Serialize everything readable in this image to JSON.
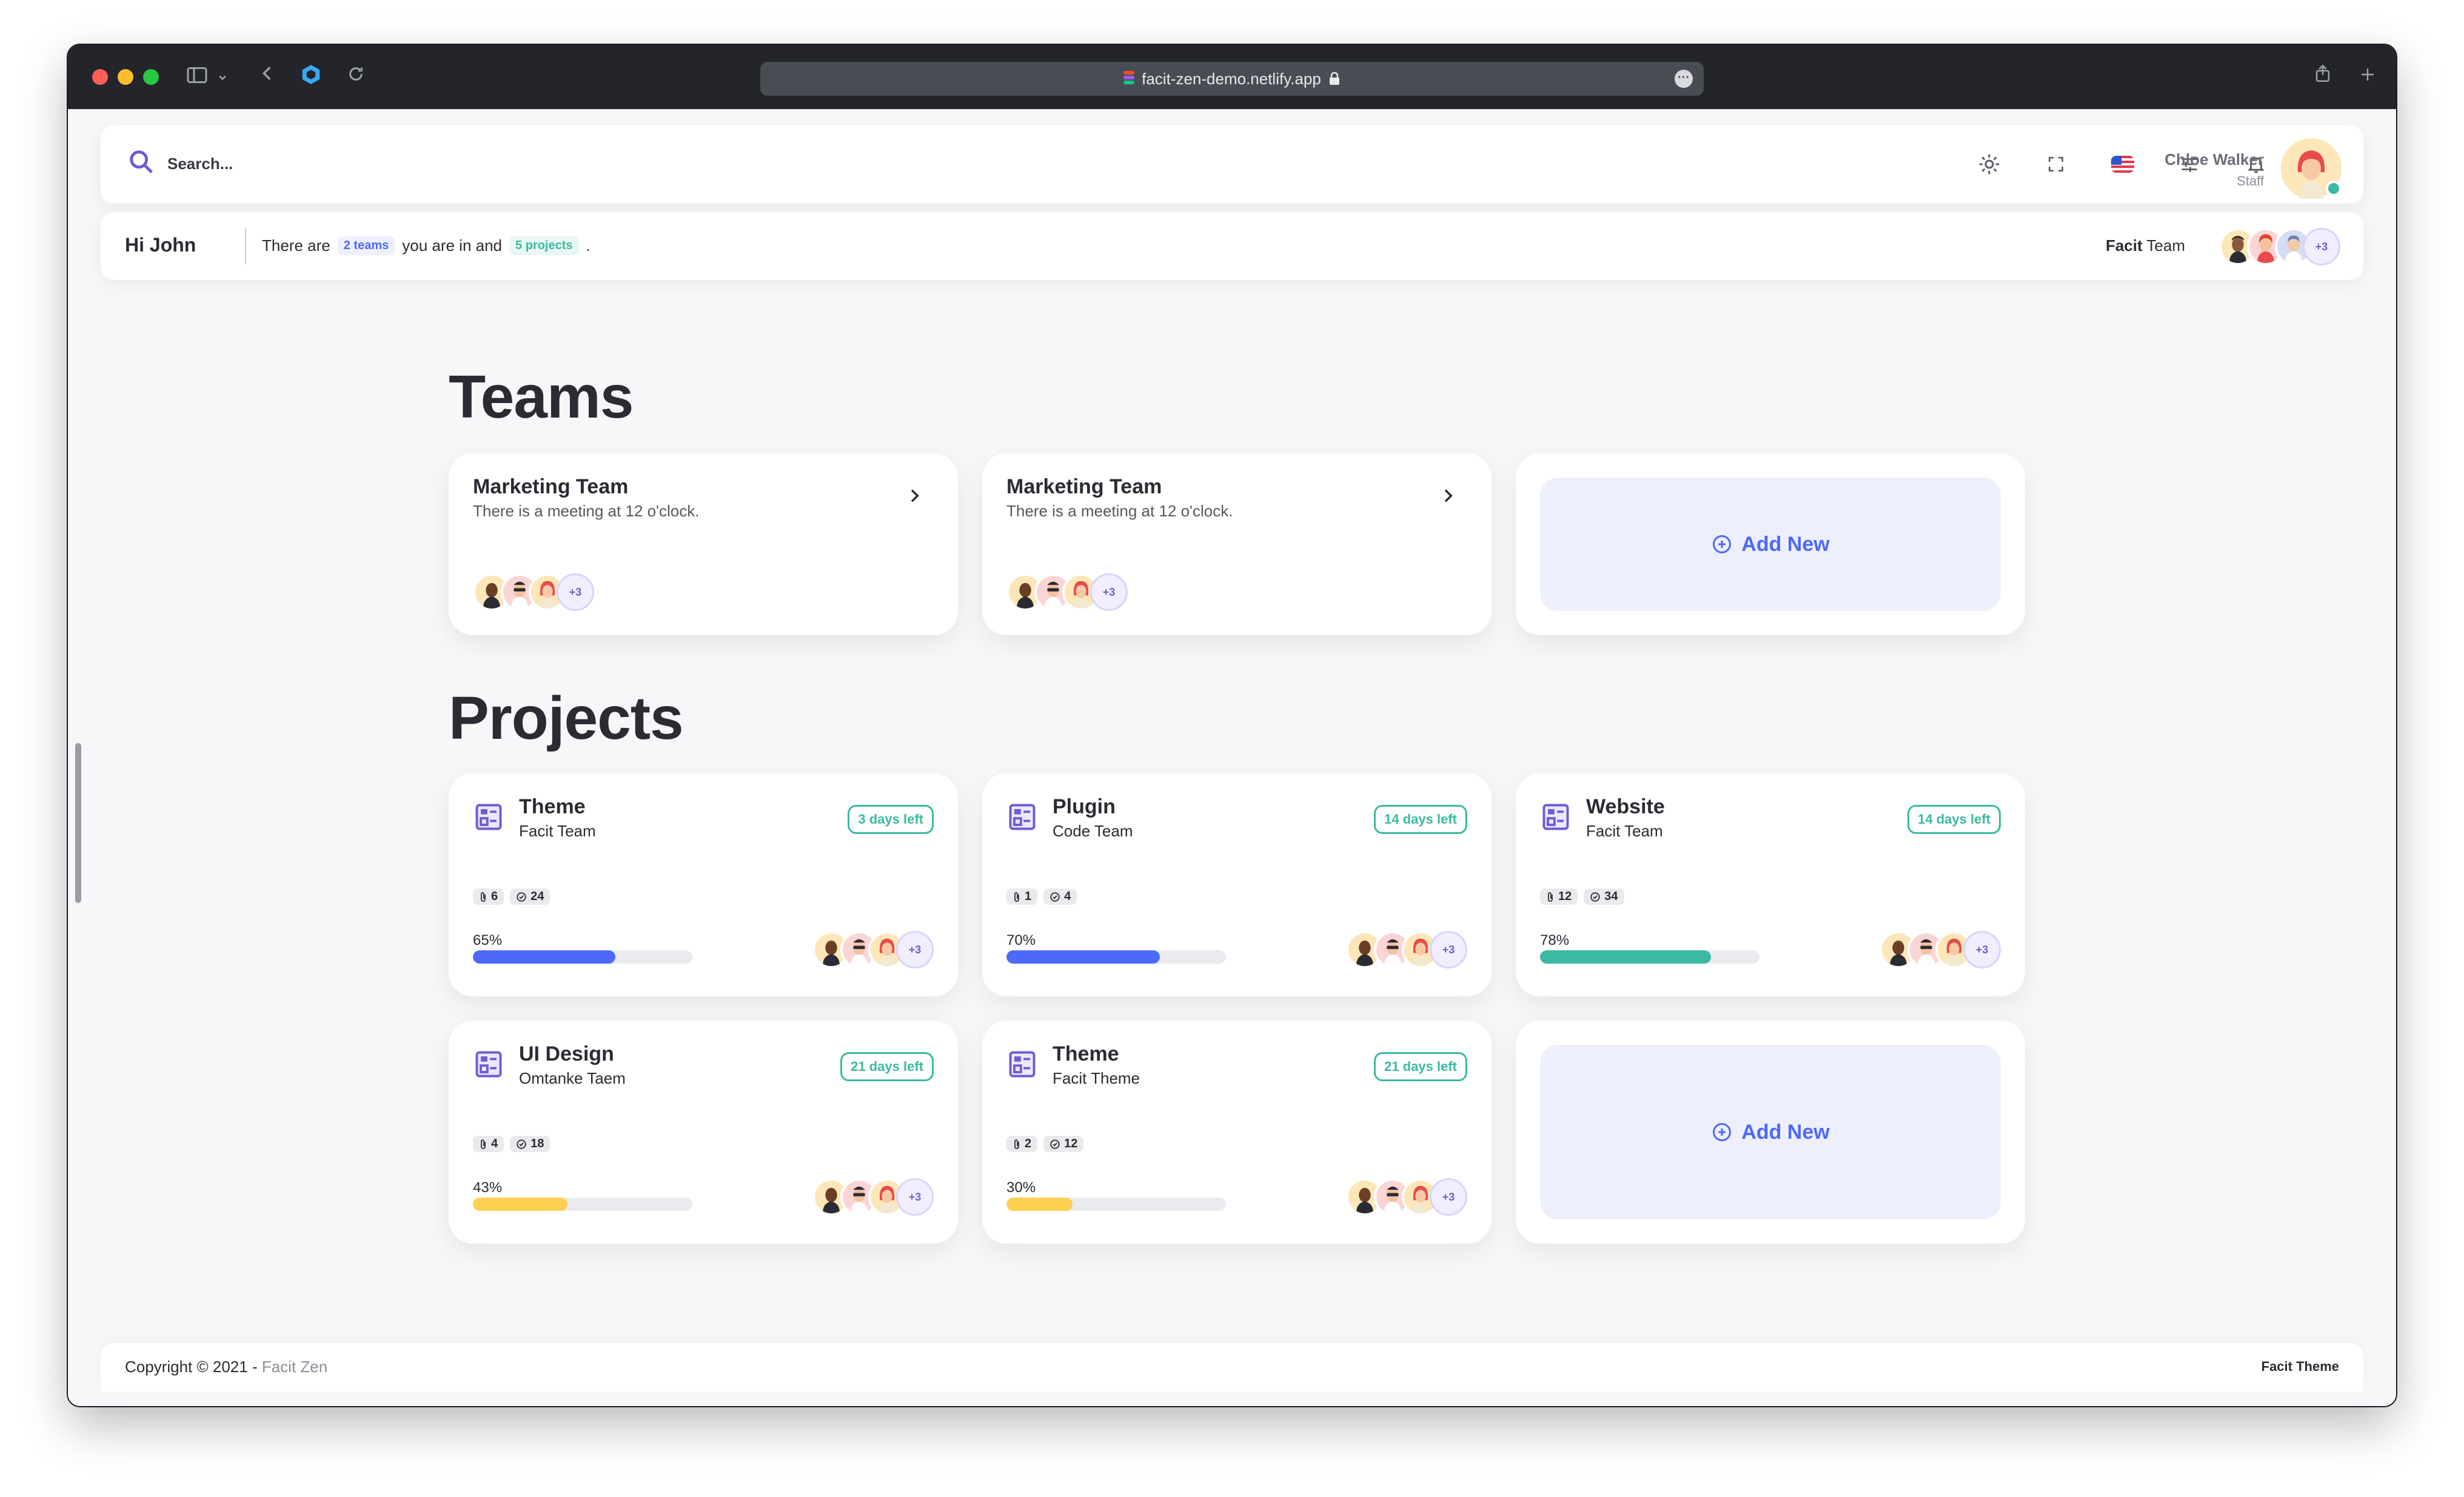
{
  "browser": {
    "url": "facit-zen-demo.netlify.app"
  },
  "header": {
    "search_placeholder": "Search...",
    "user_name": "Chloe Walker",
    "user_role": "Staff"
  },
  "subheader": {
    "greeting": "Hi John",
    "text_before": "There are",
    "teams_pill": "2 teams",
    "text_middle": "you are in and",
    "projects_pill": "5 projects",
    "text_end": ".",
    "team_brand": "Facit",
    "team_word": "Team",
    "more_count": "+3"
  },
  "teams": {
    "title": "Teams",
    "cards": [
      {
        "name": "Marketing Team",
        "desc": "There is a meeting at 12 o'clock.",
        "more": "+3"
      },
      {
        "name": "Marketing Team",
        "desc": "There is a meeting at 12 o'clock.",
        "more": "+3"
      }
    ],
    "add_new": "Add New"
  },
  "projects": {
    "title": "Projects",
    "cards": [
      {
        "name": "Theme",
        "team": "Facit Team",
        "days": "3 days left",
        "attachments": "6",
        "tasks": "24",
        "percent_label": "65%",
        "progress": 0.65,
        "color": "#4d69fa",
        "more": "+3"
      },
      {
        "name": "Plugin",
        "team": "Code Team",
        "days": "14 days left",
        "attachments": "1",
        "tasks": "4",
        "percent_label": "70%",
        "progress": 0.7,
        "color": "#4d69fa",
        "more": "+3"
      },
      {
        "name": "Website",
        "team": "Facit Team",
        "days": "14 days left",
        "attachments": "12",
        "tasks": "34",
        "percent_label": "78%",
        "progress": 0.78,
        "color": "#3bb9a1",
        "more": "+3"
      },
      {
        "name": "UI Design",
        "team": "Omtanke Taem",
        "days": "21 days left",
        "attachments": "4",
        "tasks": "18",
        "percent_label": "43%",
        "progress": 0.43,
        "color": "#ffcf52",
        "more": "+3"
      },
      {
        "name": "Theme",
        "team": "Facit Theme",
        "days": "21 days left",
        "attachments": "2",
        "tasks": "12",
        "percent_label": "30%",
        "progress": 0.3,
        "color": "#ffcf52",
        "more": "+3"
      }
    ],
    "add_new": "Add New"
  },
  "footer": {
    "copyright": "Copyright © 2021 -",
    "brand": "Facit Zen",
    "right": "Facit Theme"
  },
  "colors": {
    "primary": "#4d69fa",
    "success": "#3bb9a1",
    "warning": "#ffcf52",
    "accent": "#6c5dd3"
  }
}
